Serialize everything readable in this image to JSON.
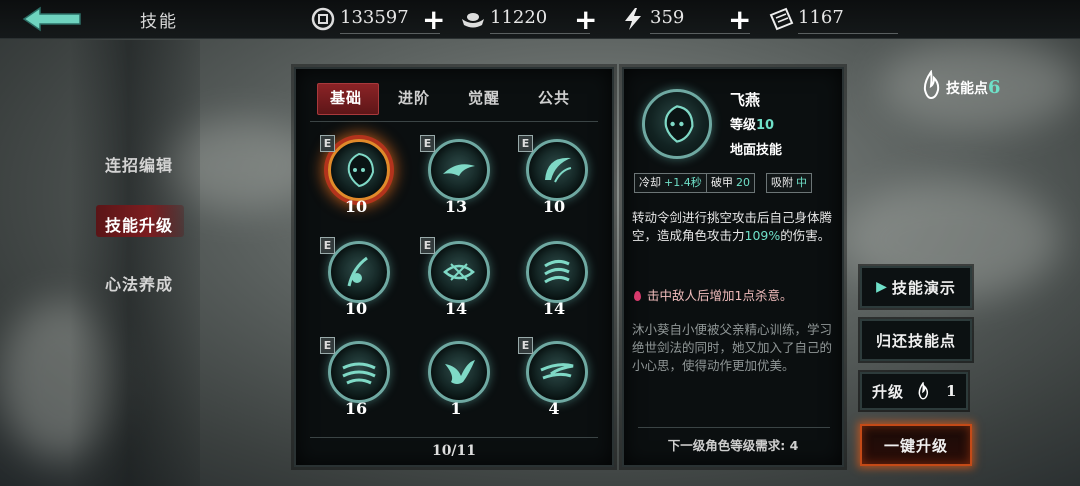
{
  "header": {
    "title": "技能",
    "resources": [
      {
        "icon": "coin-icon",
        "value": "133597"
      },
      {
        "icon": "silver-ingot-icon",
        "value": "11220"
      },
      {
        "icon": "energy-bolt-icon",
        "value": "359"
      },
      {
        "icon": "ticket-icon",
        "value": "1167"
      }
    ]
  },
  "sidebar": {
    "items": [
      {
        "label": "连招编辑"
      },
      {
        "label": "技能升级",
        "active": true
      },
      {
        "label": "心法养成"
      }
    ]
  },
  "skill_panel": {
    "tabs": [
      {
        "label": "基础",
        "active": true
      },
      {
        "label": "进阶"
      },
      {
        "label": "觉醒"
      },
      {
        "label": "公共"
      }
    ],
    "skills": [
      {
        "level": "10",
        "equipped": true,
        "selected": true,
        "icon": "reaper-hood-icon"
      },
      {
        "level": "13",
        "equipped": true,
        "icon": "flying-swallow-icon"
      },
      {
        "level": "10",
        "equipped": true,
        "icon": "crescent-slash-icon"
      },
      {
        "level": "10",
        "equipped": true,
        "icon": "sword-dancer-icon"
      },
      {
        "level": "14",
        "equipped": true,
        "icon": "whirlwind-icon"
      },
      {
        "level": "14",
        "equipped": false,
        "icon": "claw-strike-icon"
      },
      {
        "level": "16",
        "equipped": true,
        "icon": "wave-slash-icon"
      },
      {
        "level": "1",
        "equipped": false,
        "icon": "eagle-icon"
      },
      {
        "level": "4",
        "equipped": true,
        "icon": "wind-blade-icon"
      }
    ],
    "page": "10/11"
  },
  "detail": {
    "name": "飞燕",
    "level_label": "等级",
    "level": "10",
    "type": "地面技能",
    "stats": [
      {
        "label": "冷却",
        "value": "+1.4秒"
      },
      {
        "label": "破甲",
        "value": "20"
      },
      {
        "label": "吸附",
        "value": "中"
      }
    ],
    "desc_part1": "转动令剑进行挑空攻击后自己身体腾空，造成角色攻击力",
    "desc_highlight": "109%",
    "desc_part2": "的伤害。",
    "bonus": "击中敌人后增加1点杀意。",
    "lore": "沐小葵自小便被父亲精心训练，学习绝世剑法的同时，她又加入了自己的小心思，使得动作更加优美。",
    "requirement": "下一级角色等级需求: 4"
  },
  "right": {
    "points_label": "技能点",
    "points_value": "6",
    "demo_label": "技能演示",
    "refund_label": "归还技能点",
    "upgrade_label": "升级",
    "upgrade_cost": "1",
    "one_click_label": "一键升级"
  },
  "colors": {
    "accent_teal": "#6fe0c8",
    "active_red": "#8b2326",
    "glow_orange": "#e08a2a"
  }
}
